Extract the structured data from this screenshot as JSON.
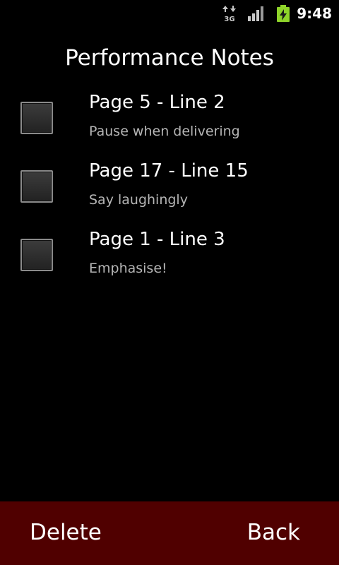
{
  "status_bar": {
    "time": "9:48",
    "network_label": "3G",
    "icons": [
      "3g-data-icon",
      "signal-strength-icon",
      "battery-charging-icon"
    ]
  },
  "title": "Performance Notes",
  "notes": [
    {
      "title": "Page 5 - Line 2",
      "subtitle": "Pause when delivering",
      "checked": false
    },
    {
      "title": "Page 17 - Line 15",
      "subtitle": "Say laughingly",
      "checked": false
    },
    {
      "title": "Page 1 - Line 3",
      "subtitle": "Emphasise!",
      "checked": false
    }
  ],
  "bottom_bar": {
    "delete_label": "Delete",
    "back_label": "Back"
  },
  "colors": {
    "background": "#000000",
    "bottom_bar": "#500000",
    "subtitle_text": "#b5b5b5",
    "battery": "#8fd42a"
  }
}
